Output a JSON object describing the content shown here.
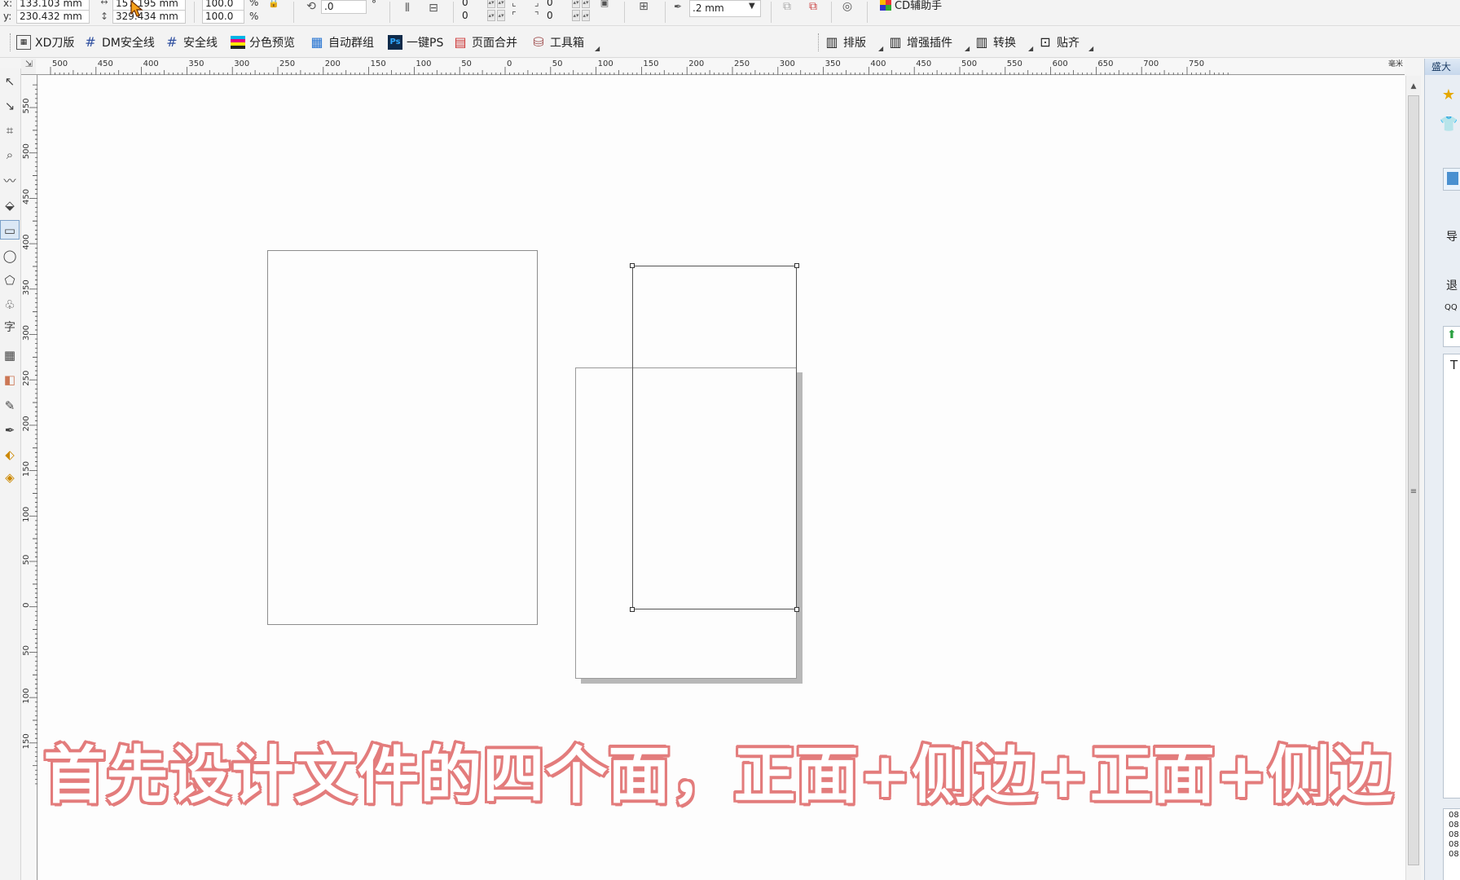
{
  "property_bar": {
    "x_label": "x:",
    "x_value": "133.103 mm",
    "y_label": "y:",
    "y_value": "230.432 mm",
    "width_value": "157.195 mm",
    "height_value": "329.434 mm",
    "scale_w": "100.0",
    "scale_h": "100.0",
    "percent": "%",
    "rotation": ".0",
    "degree": "°",
    "offset_a1": "0",
    "offset_a2": "0",
    "offset_b1": "0",
    "offset_b2": "0",
    "outline_width": ".2 mm",
    "cd_helper": "CD辅助手"
  },
  "plugin_toolbar": {
    "items": [
      {
        "label": "XD刀版",
        "icon": "knife-die-icon"
      },
      {
        "label": "DM安全线",
        "icon": "grid-icon"
      },
      {
        "label": "安全线",
        "icon": "grid-icon"
      },
      {
        "label": "分色预览",
        "icon": "color-separation-icon"
      },
      {
        "label": "自动群组",
        "icon": "group-icon"
      },
      {
        "label": "一键PS",
        "icon": "photoshop-icon"
      },
      {
        "label": "页面合并",
        "icon": "page-merge-icon"
      },
      {
        "label": "工具箱",
        "icon": "toolbox-icon"
      }
    ],
    "right_items": [
      {
        "label": "排版",
        "icon": "layout-icon"
      },
      {
        "label": "增强插件",
        "icon": "plugin-icon"
      },
      {
        "label": "转换",
        "icon": "convert-icon"
      },
      {
        "label": "贴齐",
        "icon": "snap-icon"
      }
    ]
  },
  "ruler": {
    "top_ticks": [
      "500",
      "450",
      "400",
      "350",
      "300",
      "250",
      "200",
      "150",
      "100",
      "50",
      "0",
      "50",
      "100",
      "150",
      "200",
      "250",
      "300",
      "350",
      "400",
      "450",
      "500",
      "550",
      "600",
      "650",
      "700",
      "750"
    ],
    "left_ticks": [
      "550",
      "500",
      "450",
      "400",
      "350",
      "300",
      "250",
      "200",
      "150",
      "100",
      "50",
      "0",
      "50",
      "100",
      "150"
    ],
    "unit": "毫米"
  },
  "docker": {
    "tab_title": "盛大",
    "label_1": "导",
    "label_2": "退",
    "qq_label": "QQ",
    "text_t": "T",
    "times": [
      "08:",
      "08:",
      "08:",
      "08:",
      "08:"
    ]
  },
  "subtitle": "首先设计文件的四个面，正面+侧边+正面+侧边"
}
